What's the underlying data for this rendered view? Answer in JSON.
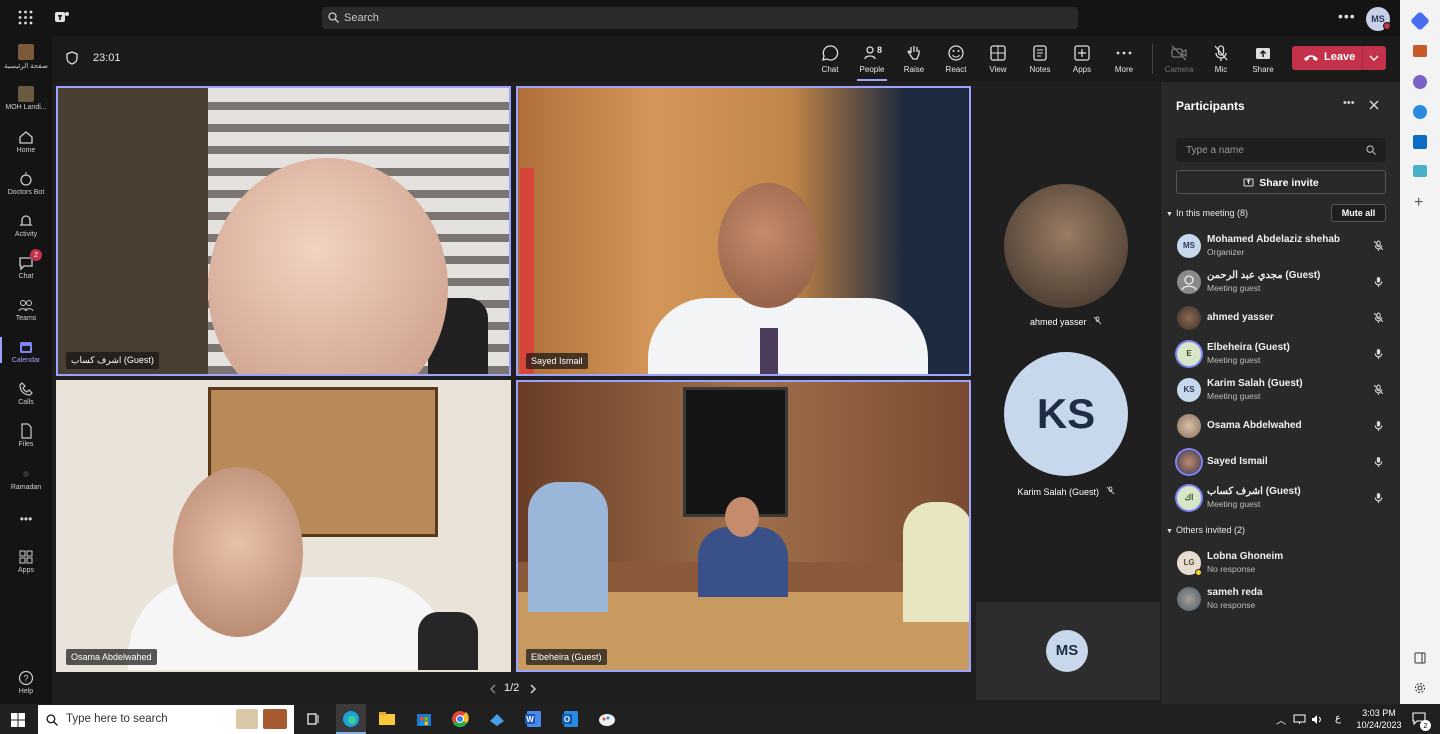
{
  "search": {
    "placeholder": "Search"
  },
  "user_initials": "MS",
  "rail": [
    {
      "label": "ﺻﻔﺤﺔ اﻟﺮﺋﻴﺴﻴﺔ",
      "icon": "org-logo-icon"
    },
    {
      "label": "MOH Landi...",
      "icon": "org-logo-icon"
    },
    {
      "label": "Home",
      "icon": "home-icon"
    },
    {
      "label": "Doctors Bot",
      "icon": "bot-icon"
    },
    {
      "label": "Activity",
      "icon": "bell-icon"
    },
    {
      "label": "Chat",
      "icon": "chat-icon",
      "badge": "2"
    },
    {
      "label": "Teams",
      "icon": "teams-icon"
    },
    {
      "label": "Calendar",
      "icon": "calendar-icon"
    },
    {
      "label": "Calls",
      "icon": "phone-icon"
    },
    {
      "label": "Files",
      "icon": "file-icon"
    },
    {
      "label": "Ramadan",
      "icon": "moon-icon"
    },
    {
      "label": "Apps",
      "icon": "apps-icon"
    },
    {
      "label": "Help",
      "icon": "help-icon"
    }
  ],
  "call": {
    "timer": "23:01",
    "people_count": "8",
    "toolbar": [
      "Chat",
      "People",
      "Raise",
      "React",
      "View",
      "Notes",
      "Apps",
      "More",
      "Camera",
      "Mic",
      "Share"
    ],
    "leave_label": "Leave",
    "pager": "1/2"
  },
  "tiles": [
    {
      "name": "اشرف كساب (Guest)"
    },
    {
      "name": "Sayed Ismail"
    },
    {
      "name": "Osama Abdelwahed"
    },
    {
      "name": "Elbeheira (Guest)"
    }
  ],
  "side_tiles": [
    {
      "name": "ahmed yasser"
    },
    {
      "name": "Karim Salah (Guest)",
      "initials": "KS"
    },
    {
      "initials": "MS"
    }
  ],
  "participants": {
    "title": "Participants",
    "search_placeholder": "Type a name",
    "share_invite": "Share invite",
    "in_meeting_label": "In this meeting (8)",
    "mute_all": "Mute all",
    "in_meeting": [
      {
        "name": "Mohamed Abdelaziz shehab",
        "role": "Organizer",
        "initials": "MS",
        "muted": true
      },
      {
        "name": "مجدي عبد الرحمن (Guest)",
        "role": "Meeting guest",
        "initials": "",
        "muted": false
      },
      {
        "name": "ahmed yasser",
        "role": "",
        "initials": "",
        "muted": true
      },
      {
        "name": "Elbeheira (Guest)",
        "role": "Meeting guest",
        "initials": "E",
        "muted": false
      },
      {
        "name": "Karim Salah (Guest)",
        "role": "Meeting guest",
        "initials": "KS",
        "muted": true
      },
      {
        "name": "Osama Abdelwahed",
        "role": "",
        "initials": "",
        "muted": false
      },
      {
        "name": "Sayed Ismail",
        "role": "",
        "initials": "",
        "muted": false
      },
      {
        "name": "اشرف كساب (Guest)",
        "role": "Meeting guest",
        "initials": "اك",
        "muted": false
      }
    ],
    "others_label": "Others invited (2)",
    "others": [
      {
        "name": "Lobna Ghoneim",
        "role": "No response",
        "initials": "LG"
      },
      {
        "name": "sameh reda",
        "role": "No response",
        "initials": ""
      }
    ]
  },
  "taskbar": {
    "search_placeholder": "Type here to search",
    "time": "3:03 PM",
    "date": "10/24/2023",
    "lang": "ع",
    "notif_count": "2"
  }
}
